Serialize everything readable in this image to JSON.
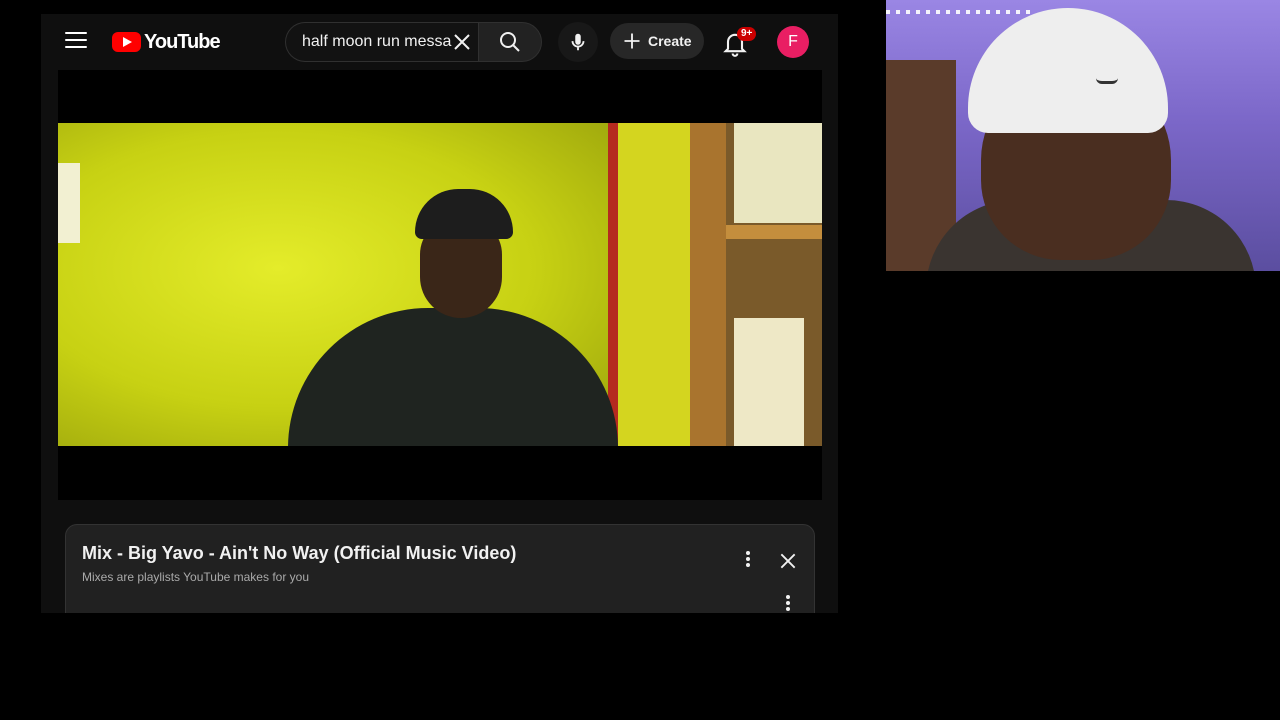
{
  "header": {
    "logo_text": "YouTube",
    "search_value": "half moon run messa",
    "create_label": "Create",
    "notification_badge": "9+",
    "avatar_initial": "F"
  },
  "playlist": {
    "title": "Mix - Big Yavo - Ain't No Way (Official Music Video)",
    "subtitle": "Mixes are playlists YouTube makes for you"
  },
  "colors": {
    "brand_red": "#ff0000",
    "avatar_pink": "#e91e63",
    "badge_red": "#cc0000",
    "page_bg": "#0f0f0f"
  },
  "icons": [
    "menu-icon",
    "youtube-logo-icon",
    "close-icon",
    "search-icon",
    "mic-icon",
    "plus-icon",
    "bell-icon",
    "more-vert-icon"
  ]
}
